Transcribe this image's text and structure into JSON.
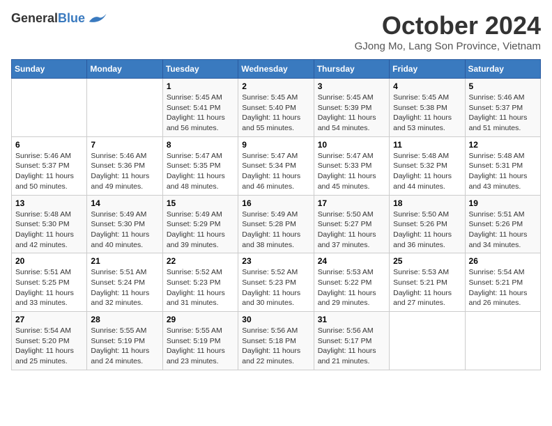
{
  "logo": {
    "general": "General",
    "blue": "Blue"
  },
  "title": "October 2024",
  "location": "GJong Mo, Lang Son Province, Vietnam",
  "days_of_week": [
    "Sunday",
    "Monday",
    "Tuesday",
    "Wednesday",
    "Thursday",
    "Friday",
    "Saturday"
  ],
  "weeks": [
    [
      {
        "day": null,
        "info": null
      },
      {
        "day": null,
        "info": null
      },
      {
        "day": "1",
        "info": "Sunrise: 5:45 AM\nSunset: 5:41 PM\nDaylight: 11 hours and 56 minutes."
      },
      {
        "day": "2",
        "info": "Sunrise: 5:45 AM\nSunset: 5:40 PM\nDaylight: 11 hours and 55 minutes."
      },
      {
        "day": "3",
        "info": "Sunrise: 5:45 AM\nSunset: 5:39 PM\nDaylight: 11 hours and 54 minutes."
      },
      {
        "day": "4",
        "info": "Sunrise: 5:45 AM\nSunset: 5:38 PM\nDaylight: 11 hours and 53 minutes."
      },
      {
        "day": "5",
        "info": "Sunrise: 5:46 AM\nSunset: 5:37 PM\nDaylight: 11 hours and 51 minutes."
      }
    ],
    [
      {
        "day": "6",
        "info": "Sunrise: 5:46 AM\nSunset: 5:37 PM\nDaylight: 11 hours and 50 minutes."
      },
      {
        "day": "7",
        "info": "Sunrise: 5:46 AM\nSunset: 5:36 PM\nDaylight: 11 hours and 49 minutes."
      },
      {
        "day": "8",
        "info": "Sunrise: 5:47 AM\nSunset: 5:35 PM\nDaylight: 11 hours and 48 minutes."
      },
      {
        "day": "9",
        "info": "Sunrise: 5:47 AM\nSunset: 5:34 PM\nDaylight: 11 hours and 46 minutes."
      },
      {
        "day": "10",
        "info": "Sunrise: 5:47 AM\nSunset: 5:33 PM\nDaylight: 11 hours and 45 minutes."
      },
      {
        "day": "11",
        "info": "Sunrise: 5:48 AM\nSunset: 5:32 PM\nDaylight: 11 hours and 44 minutes."
      },
      {
        "day": "12",
        "info": "Sunrise: 5:48 AM\nSunset: 5:31 PM\nDaylight: 11 hours and 43 minutes."
      }
    ],
    [
      {
        "day": "13",
        "info": "Sunrise: 5:48 AM\nSunset: 5:30 PM\nDaylight: 11 hours and 42 minutes."
      },
      {
        "day": "14",
        "info": "Sunrise: 5:49 AM\nSunset: 5:30 PM\nDaylight: 11 hours and 40 minutes."
      },
      {
        "day": "15",
        "info": "Sunrise: 5:49 AM\nSunset: 5:29 PM\nDaylight: 11 hours and 39 minutes."
      },
      {
        "day": "16",
        "info": "Sunrise: 5:49 AM\nSunset: 5:28 PM\nDaylight: 11 hours and 38 minutes."
      },
      {
        "day": "17",
        "info": "Sunrise: 5:50 AM\nSunset: 5:27 PM\nDaylight: 11 hours and 37 minutes."
      },
      {
        "day": "18",
        "info": "Sunrise: 5:50 AM\nSunset: 5:26 PM\nDaylight: 11 hours and 36 minutes."
      },
      {
        "day": "19",
        "info": "Sunrise: 5:51 AM\nSunset: 5:26 PM\nDaylight: 11 hours and 34 minutes."
      }
    ],
    [
      {
        "day": "20",
        "info": "Sunrise: 5:51 AM\nSunset: 5:25 PM\nDaylight: 11 hours and 33 minutes."
      },
      {
        "day": "21",
        "info": "Sunrise: 5:51 AM\nSunset: 5:24 PM\nDaylight: 11 hours and 32 minutes."
      },
      {
        "day": "22",
        "info": "Sunrise: 5:52 AM\nSunset: 5:23 PM\nDaylight: 11 hours and 31 minutes."
      },
      {
        "day": "23",
        "info": "Sunrise: 5:52 AM\nSunset: 5:23 PM\nDaylight: 11 hours and 30 minutes."
      },
      {
        "day": "24",
        "info": "Sunrise: 5:53 AM\nSunset: 5:22 PM\nDaylight: 11 hours and 29 minutes."
      },
      {
        "day": "25",
        "info": "Sunrise: 5:53 AM\nSunset: 5:21 PM\nDaylight: 11 hours and 27 minutes."
      },
      {
        "day": "26",
        "info": "Sunrise: 5:54 AM\nSunset: 5:21 PM\nDaylight: 11 hours and 26 minutes."
      }
    ],
    [
      {
        "day": "27",
        "info": "Sunrise: 5:54 AM\nSunset: 5:20 PM\nDaylight: 11 hours and 25 minutes."
      },
      {
        "day": "28",
        "info": "Sunrise: 5:55 AM\nSunset: 5:19 PM\nDaylight: 11 hours and 24 minutes."
      },
      {
        "day": "29",
        "info": "Sunrise: 5:55 AM\nSunset: 5:19 PM\nDaylight: 11 hours and 23 minutes."
      },
      {
        "day": "30",
        "info": "Sunrise: 5:56 AM\nSunset: 5:18 PM\nDaylight: 11 hours and 22 minutes."
      },
      {
        "day": "31",
        "info": "Sunrise: 5:56 AM\nSunset: 5:17 PM\nDaylight: 11 hours and 21 minutes."
      },
      {
        "day": null,
        "info": null
      },
      {
        "day": null,
        "info": null
      }
    ]
  ]
}
